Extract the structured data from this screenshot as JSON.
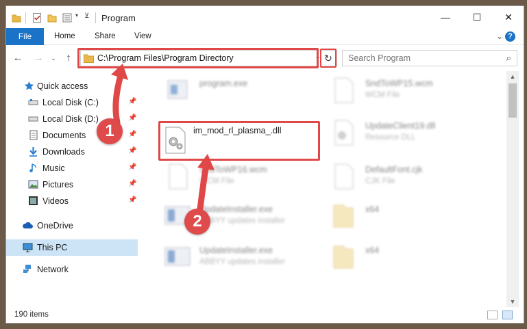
{
  "window": {
    "title": "Program",
    "controls": {
      "minimize": "—",
      "maximize": "☐",
      "close": "✕"
    }
  },
  "ribbon": {
    "tabs": [
      "File",
      "Home",
      "Share",
      "View"
    ],
    "help": "?"
  },
  "address": {
    "path": "C:\\Program Files\\Program Directory"
  },
  "search": {
    "placeholder": "Search Program"
  },
  "sidebar": {
    "items": [
      {
        "label": "Quick access",
        "icon": "star-icon"
      },
      {
        "label": "Local Disk (C:)",
        "icon": "drive-icon",
        "pinned": true
      },
      {
        "label": "Local Disk (D:)",
        "icon": "drive-icon",
        "pinned": true
      },
      {
        "label": "Documents",
        "icon": "documents-icon",
        "pinned": true
      },
      {
        "label": "Downloads",
        "icon": "download-icon",
        "pinned": true
      },
      {
        "label": "Music",
        "icon": "music-icon",
        "pinned": true
      },
      {
        "label": "Pictures",
        "icon": "pictures-icon",
        "pinned": true
      },
      {
        "label": "Videos",
        "icon": "videos-icon",
        "pinned": true
      },
      {
        "label": "OneDrive",
        "icon": "cloud-icon"
      },
      {
        "label": "This PC",
        "icon": "computer-icon",
        "selected": true
      },
      {
        "label": "Network",
        "icon": "network-icon"
      }
    ]
  },
  "files": [
    {
      "name": "program.exe",
      "desc": "",
      "blurred": true,
      "icon": "exe-icon"
    },
    {
      "name": "im_mod_rl_plasma_.dll",
      "desc": "",
      "blurred": false,
      "icon": "dll-gear-icon"
    },
    {
      "name": "SndToWP16.wcm",
      "desc": "WCM File",
      "blurred": true,
      "icon": "file-icon"
    },
    {
      "name": "UpdateInstaller.exe",
      "desc": "ABBYY updates installer",
      "blurred": true,
      "icon": "exe-icon"
    },
    {
      "name": "UpdateInstaller.exe",
      "desc": "ABBYY updates installer",
      "blurred": true,
      "icon": "exe-icon"
    },
    {
      "name": "SndToWP15.wcm",
      "desc": "WCM File",
      "blurred": true,
      "icon": "file-icon"
    },
    {
      "name": "UpdateClient19.dll",
      "desc": "Resource DLL",
      "blurred": true,
      "icon": "dll-gear-icon"
    },
    {
      "name": "DefaultFont.cjk",
      "desc": "CJK File",
      "blurred": true,
      "icon": "file-icon"
    },
    {
      "name": "x64",
      "desc": "",
      "blurred": true,
      "icon": "folder-icon"
    },
    {
      "name": "x64",
      "desc": "",
      "blurred": true,
      "icon": "folder-icon"
    }
  ],
  "status": {
    "count": "190 items"
  },
  "callouts": [
    "1",
    "2"
  ],
  "colors": {
    "accent": "#1a73c6",
    "highlight": "#e04848",
    "selected": "#cde4f7"
  }
}
